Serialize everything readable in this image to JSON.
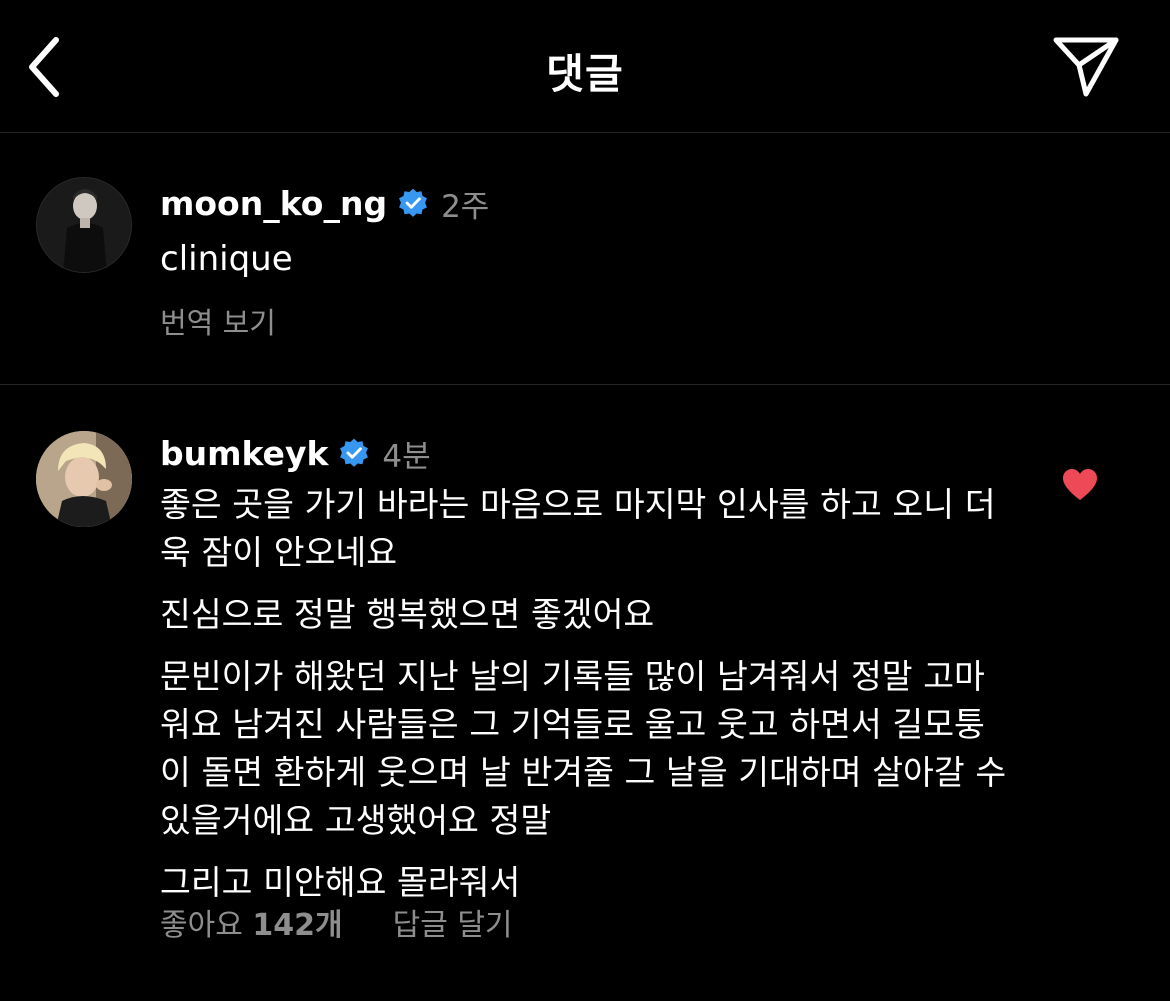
{
  "header": {
    "title": "댓글",
    "back_icon": "chevron-left-icon",
    "share_icon": "paper-plane-icon"
  },
  "comments": [
    {
      "username": "moon_ko_ng",
      "verified": true,
      "time": "2주",
      "text": "clinique",
      "translate_label": "번역 보기"
    },
    {
      "username": "bumkeyk",
      "verified": true,
      "time": "4분",
      "paragraphs": [
        "좋은 곳을 가기 바라는 마음으로 마지막 인사를 하고 오니 더욱 잠이 안오네요",
        "진심으로 정말 행복했으면 좋겠어요",
        "문빈이가 해왔던 지난 날의 기록들 많이 남겨줘서 정말 고마워요 남겨진 사람들은 그 기억들로 울고 웃고 하면서 길모퉁이 돌면 환하게 웃으며 날 반겨줄 그 날을 기대하며 살아갈 수 있을거에요 고생했어요 정말",
        "그리고 미안해요 몰라줘서"
      ],
      "likes_prefix": "좋아요",
      "likes_count": "142개",
      "reply_label": "답글 달기",
      "liked": true
    }
  ],
  "colors": {
    "background": "#000000",
    "text": "#ffffff",
    "secondary_text": "#8e8e8e",
    "verified_badge": "#3897f0",
    "heart": "#ed4956",
    "divider": "#262626"
  }
}
